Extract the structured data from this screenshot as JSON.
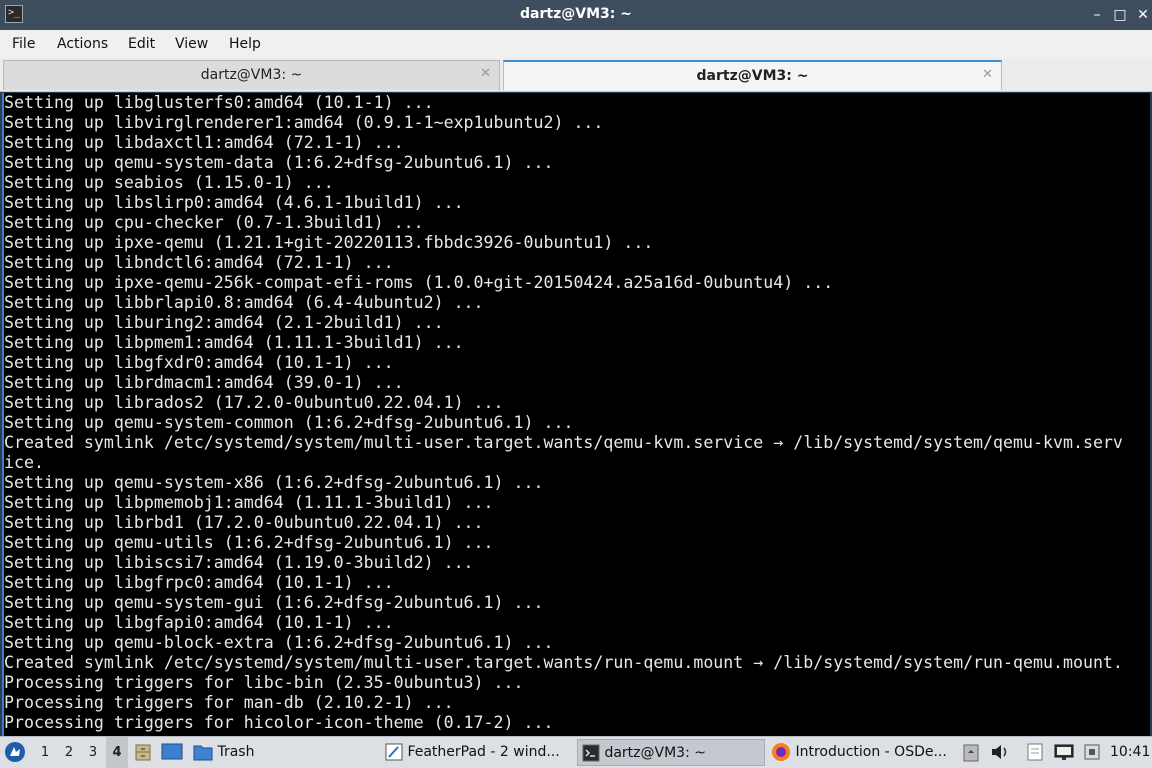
{
  "window": {
    "title": "dartz@VM3: ~",
    "app_icon_glyph": ">_",
    "controls": {
      "minimize": "–",
      "maximize": "□",
      "close": "✕"
    }
  },
  "menu": [
    "File",
    "Actions",
    "Edit",
    "View",
    "Help"
  ],
  "tabs": [
    {
      "label": "dartz@VM3: ~",
      "active": false,
      "close": "✕"
    },
    {
      "label": "dartz@VM3: ~",
      "active": true,
      "close": "✕"
    }
  ],
  "terminal": {
    "lines": [
      "Setting up libglusterfs0:amd64 (10.1-1) ...",
      "Setting up libvirglrenderer1:amd64 (0.9.1-1~exp1ubuntu2) ...",
      "Setting up libdaxctl1:amd64 (72.1-1) ...",
      "Setting up qemu-system-data (1:6.2+dfsg-2ubuntu6.1) ...",
      "Setting up seabios (1.15.0-1) ...",
      "Setting up libslirp0:amd64 (4.6.1-1build1) ...",
      "Setting up cpu-checker (0.7-1.3build1) ...",
      "Setting up ipxe-qemu (1.21.1+git-20220113.fbbdc3926-0ubuntu1) ...",
      "Setting up libndctl6:amd64 (72.1-1) ...",
      "Setting up ipxe-qemu-256k-compat-efi-roms (1.0.0+git-20150424.a25a16d-0ubuntu4) ...",
      "Setting up libbrlapi0.8:amd64 (6.4-4ubuntu2) ...",
      "Setting up liburing2:amd64 (2.1-2build1) ...",
      "Setting up libpmem1:amd64 (1.11.1-3build1) ...",
      "Setting up libgfxdr0:amd64 (10.1-1) ...",
      "Setting up librdmacm1:amd64 (39.0-1) ...",
      "Setting up librados2 (17.2.0-0ubuntu0.22.04.1) ...",
      "Setting up qemu-system-common (1:6.2+dfsg-2ubuntu6.1) ...",
      "Created symlink /etc/systemd/system/multi-user.target.wants/qemu-kvm.service → /lib/systemd/system/qemu-kvm.serv",
      "ice.",
      "Setting up qemu-system-x86 (1:6.2+dfsg-2ubuntu6.1) ...",
      "Setting up libpmemobj1:amd64 (1.11.1-3build1) ...",
      "Setting up librbd1 (17.2.0-0ubuntu0.22.04.1) ...",
      "Setting up qemu-utils (1:6.2+dfsg-2ubuntu6.1) ...",
      "Setting up libiscsi7:amd64 (1.19.0-3build2) ...",
      "Setting up libgfrpc0:amd64 (10.1-1) ...",
      "Setting up qemu-system-gui (1:6.2+dfsg-2ubuntu6.1) ...",
      "Setting up libgfapi0:amd64 (10.1-1) ...",
      "Setting up qemu-block-extra (1:6.2+dfsg-2ubuntu6.1) ...",
      "Created symlink /etc/systemd/system/multi-user.target.wants/run-qemu.mount → /lib/systemd/system/run-qemu.mount.",
      "Processing triggers for libc-bin (2.35-0ubuntu3) ...",
      "Processing triggers for man-db (2.10.2-1) ...",
      "Processing triggers for hicolor-icon-theme (0.17-2) ..."
    ]
  },
  "taskbar": {
    "workspaces": [
      "1",
      "2",
      "3",
      "4"
    ],
    "active_workspace": "4",
    "trash_label": "Trash",
    "tasks": [
      {
        "label": "FeatherPad - 2 wind...",
        "icon": "featherpad-icon",
        "active": false
      },
      {
        "label": "dartz@VM3: ~",
        "icon": "terminal-icon",
        "active": true
      },
      {
        "label": "Introduction - OSDe...",
        "icon": "firefox-icon",
        "active": false
      }
    ],
    "clock": "10:41"
  },
  "colors": {
    "titlebar": "#3d4d5d",
    "terminal_bg": "#000000",
    "terminal_fg": "#e8e8e8",
    "accent": "#3b8ed8",
    "taskbar": "#dcdfe3"
  }
}
